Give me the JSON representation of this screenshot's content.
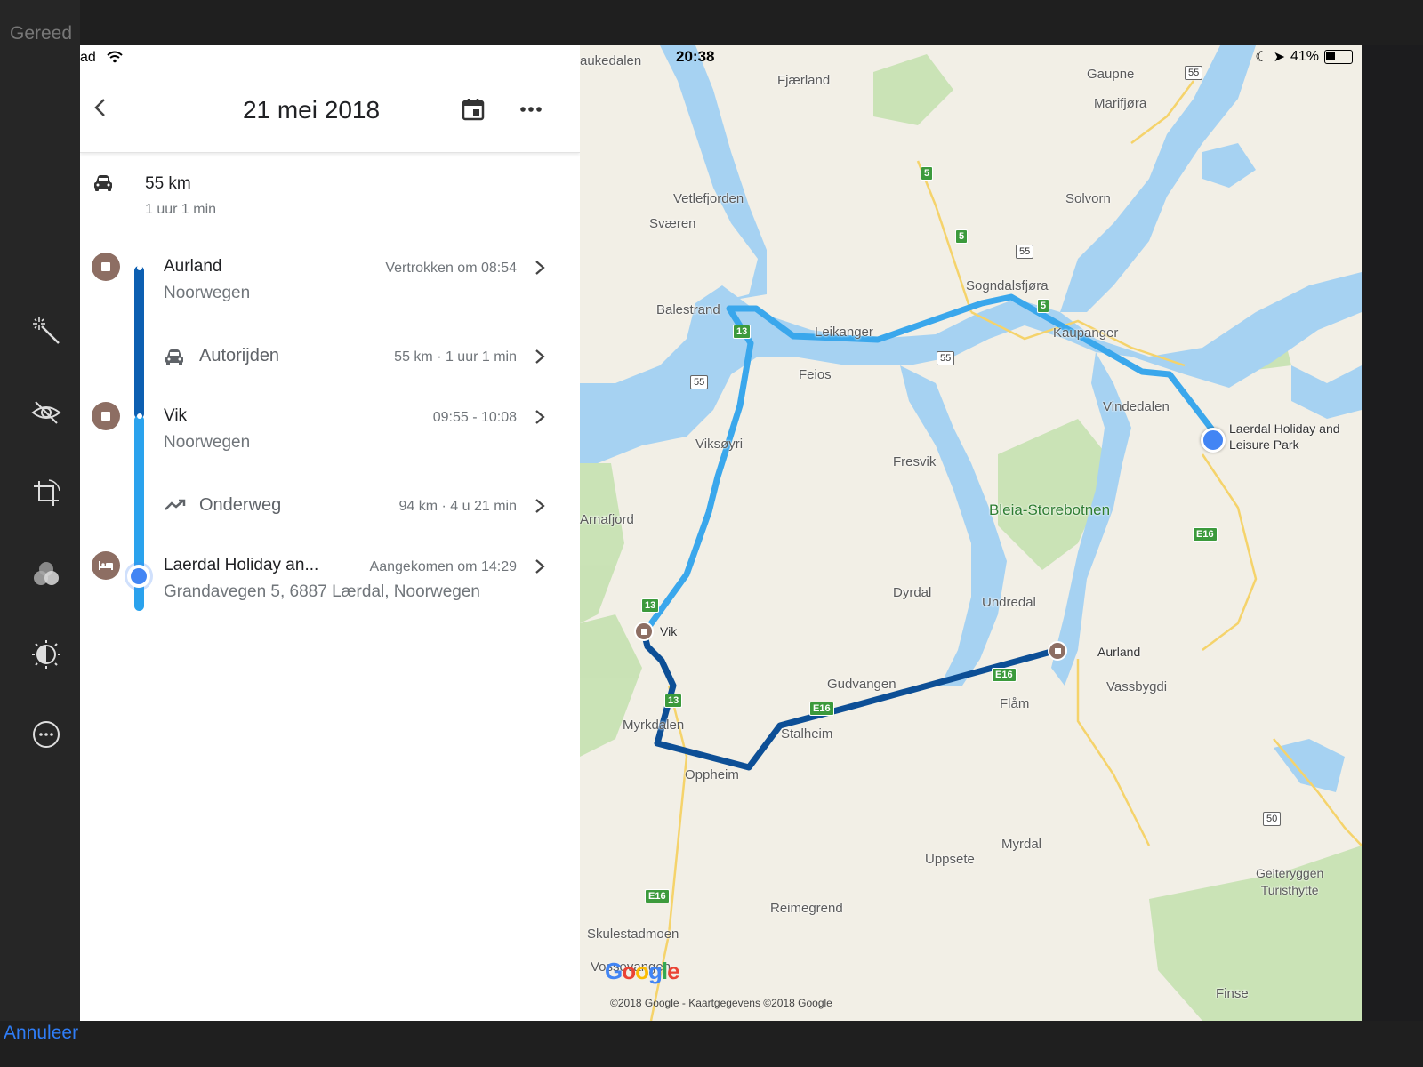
{
  "editor": {
    "done_label": "Gereed",
    "cancel_label": "Annuleer",
    "tools": [
      "magic-wand-icon",
      "eye-off-icon",
      "crop-icon",
      "filters-icon",
      "adjust-icon",
      "more-circle-icon"
    ]
  },
  "statusbar": {
    "left_partial": "ad",
    "time": "20:38",
    "battery": "41%",
    "battery_level": 0.41
  },
  "header": {
    "title": "21 mei 2018"
  },
  "summary": {
    "distance": "55 km",
    "duration": "1 uur 1 min"
  },
  "timeline": {
    "stop1": {
      "name": "Aurland",
      "country": "Noorwegen",
      "time": "Vertrokken om 08:54"
    },
    "activity1": {
      "label": "Autorijden",
      "detail": "55 km · 1 uur 1 min"
    },
    "stop2": {
      "name": "Vik",
      "country": "Noorwegen",
      "time": "09:55 - 10:08"
    },
    "activity2": {
      "label": "Onderweg",
      "detail": "94 km · 4 u 21 min"
    },
    "stop3": {
      "name": "Laerdal Holiday an...",
      "address": "Grandavegen 5, 6887 Lærdal, Noorwegen",
      "time": "Aangekomen om 14:29"
    }
  },
  "map": {
    "labels": {
      "aukedalen": "aukedalen",
      "fjaerland": "Fjærland",
      "gaupne": "Gaupne",
      "marifjora": "Marifjøra",
      "vetlefjorden": "Vetlefjorden",
      "svaeren": "Sværen",
      "solvorn": "Solvorn",
      "sogndalsfjora": "Sogndalsfjøra",
      "balestrand": "Balestrand",
      "leikanger": "Leikanger",
      "kaupanger": "Kaupanger",
      "feios": "Feios",
      "vindedalen": "Vindedalen",
      "laerdal_park": "Laerdal Holiday and\nLeisure Park",
      "viksoyri": "Viksøyri",
      "fresvik": "Fresvik",
      "bleia": "Bleia-Storebotnen",
      "arnafjord": "Arnafjord",
      "dyrdal": "Dyrdal",
      "undredal": "Undredal",
      "vik": "Vik",
      "aurland": "Aurland",
      "gudvangen": "Gudvangen",
      "vassbygdi": "Vassbygdi",
      "flam": "Flåm",
      "myrkdalen": "Myrkdalen",
      "stalheim": "Stalheim",
      "oppheim": "Oppheim",
      "myrdal": "Myrdal",
      "uppsete": "Uppsete",
      "geiteryggen": "Geiteryggen\nTuristhytte",
      "reimegrend": "Reimegrend",
      "skulestadmoen": "Skulestadmoen",
      "vossevangen": "Vossevangen",
      "finse": "Finse"
    },
    "shields": [
      "55",
      "5",
      "5",
      "55",
      "5",
      "13",
      "55",
      "55",
      "E16",
      "13",
      "13",
      "E16",
      "E16",
      "E16",
      "50"
    ],
    "google_logo": "Google",
    "copyright": "©2018 Google - Kaartgegevens ©2018 Google"
  }
}
